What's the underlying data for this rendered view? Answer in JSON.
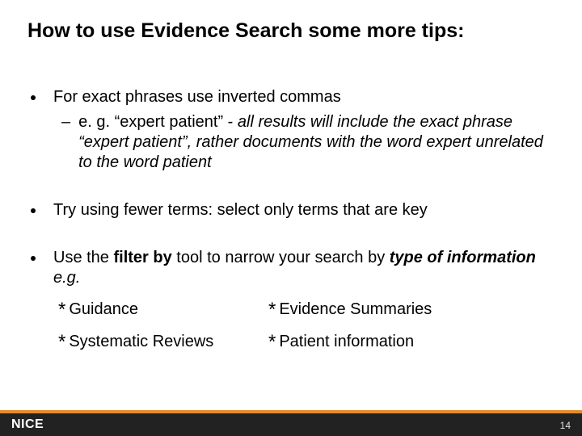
{
  "title": "How to use Evidence Search some more tips:",
  "bullets": {
    "b1": "For exact phrases use inverted commas",
    "b1_sub_lead": "e. g. “expert patient” - ",
    "b1_sub_rest": "all results will include the exact phrase “expert patient”, rather documents with the word expert unrelated to the word patient",
    "b2": "Try using fewer terms: select only terms that are key",
    "b3_p1": "Use the ",
    "b3_p2": "filter by",
    "b3_p3": " tool to narrow your search by ",
    "b3_p4": "type of information",
    "b3_p5": " e.g."
  },
  "stars": {
    "s1": "Guidance",
    "s2": "Evidence Summaries",
    "s3": "Systematic Reviews",
    "s4": "Patient information"
  },
  "footer": {
    "logo": "NICE",
    "page": "14"
  }
}
